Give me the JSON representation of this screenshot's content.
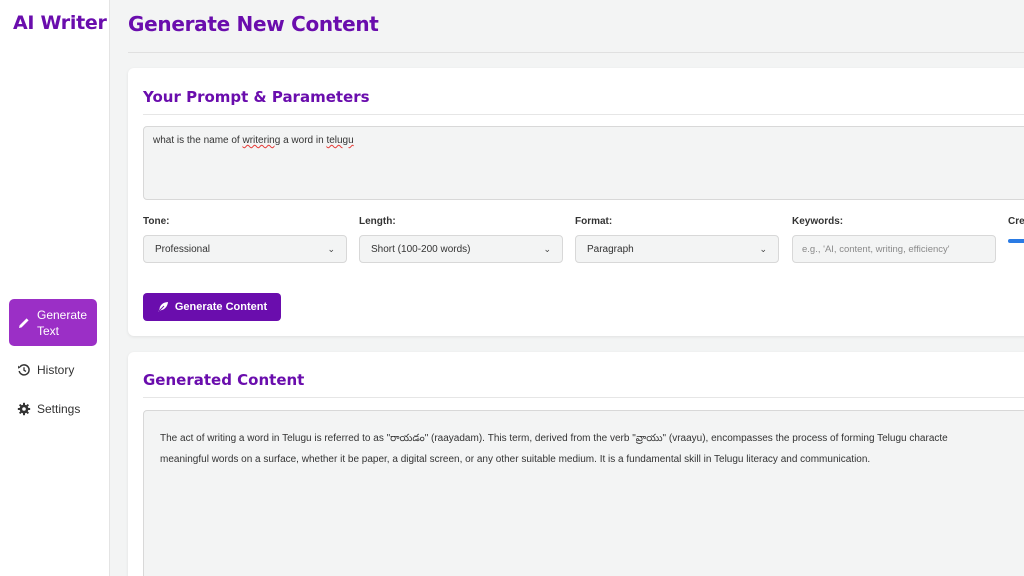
{
  "app": {
    "title": "AI Writer"
  },
  "sidebar": {
    "items": [
      {
        "label": "Generate Text",
        "icon": "pencil-icon",
        "active": true
      },
      {
        "label": "History",
        "icon": "history-icon"
      },
      {
        "label": "Settings",
        "icon": "gear-icon"
      }
    ]
  },
  "header": {
    "title": "Generate New Content"
  },
  "prompt_card": {
    "title": "Your Prompt & Parameters",
    "prompt_text": {
      "before": "what is the name of ",
      "misspelled1": "writering",
      "middle": " a word in ",
      "misspelled2": "telugu"
    },
    "params": {
      "tone": {
        "label": "Tone:",
        "value": "Professional"
      },
      "length": {
        "label": "Length:",
        "value": "Short (100-200 words)"
      },
      "format": {
        "label": "Format:",
        "value": "Paragraph"
      },
      "keywords": {
        "label": "Keywords:",
        "placeholder": "e.g., 'AI, content, writing, efficiency'"
      },
      "creativity": {
        "label": "Cre"
      }
    },
    "generate_label": "Generate Content"
  },
  "output_card": {
    "title": "Generated Content",
    "line1": "The act of writing a word in Telugu is referred to as \"రాయడం\" (raayadam). This term, derived from the verb \"వ్రాయు\" (vraayu), encompasses the process of forming Telugu characte",
    "line2": "meaningful words on a surface, whether it be paper, a digital screen, or any other suitable medium. It is a fundamental skill in Telugu literacy and communication."
  },
  "colors": {
    "accent": "#6a0dad",
    "active_nav": "#9b2fc6",
    "slider": "#2a7be4"
  }
}
